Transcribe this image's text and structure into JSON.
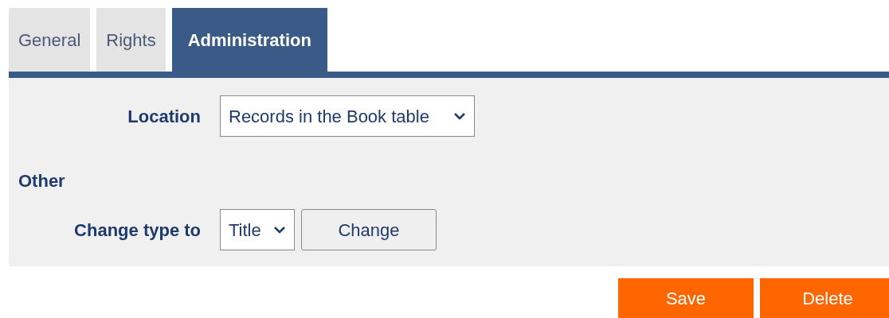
{
  "tabs": [
    {
      "label": "General",
      "selected": false
    },
    {
      "label": "Rights",
      "selected": false
    },
    {
      "label": "Administration",
      "selected": true
    }
  ],
  "location": {
    "label": "Location",
    "value": "Records in the Book table"
  },
  "other": {
    "heading": "Other",
    "label": "Change type to",
    "value": "Title",
    "button": "Change"
  },
  "buttons": [
    "Save",
    "Delete"
  ]
}
